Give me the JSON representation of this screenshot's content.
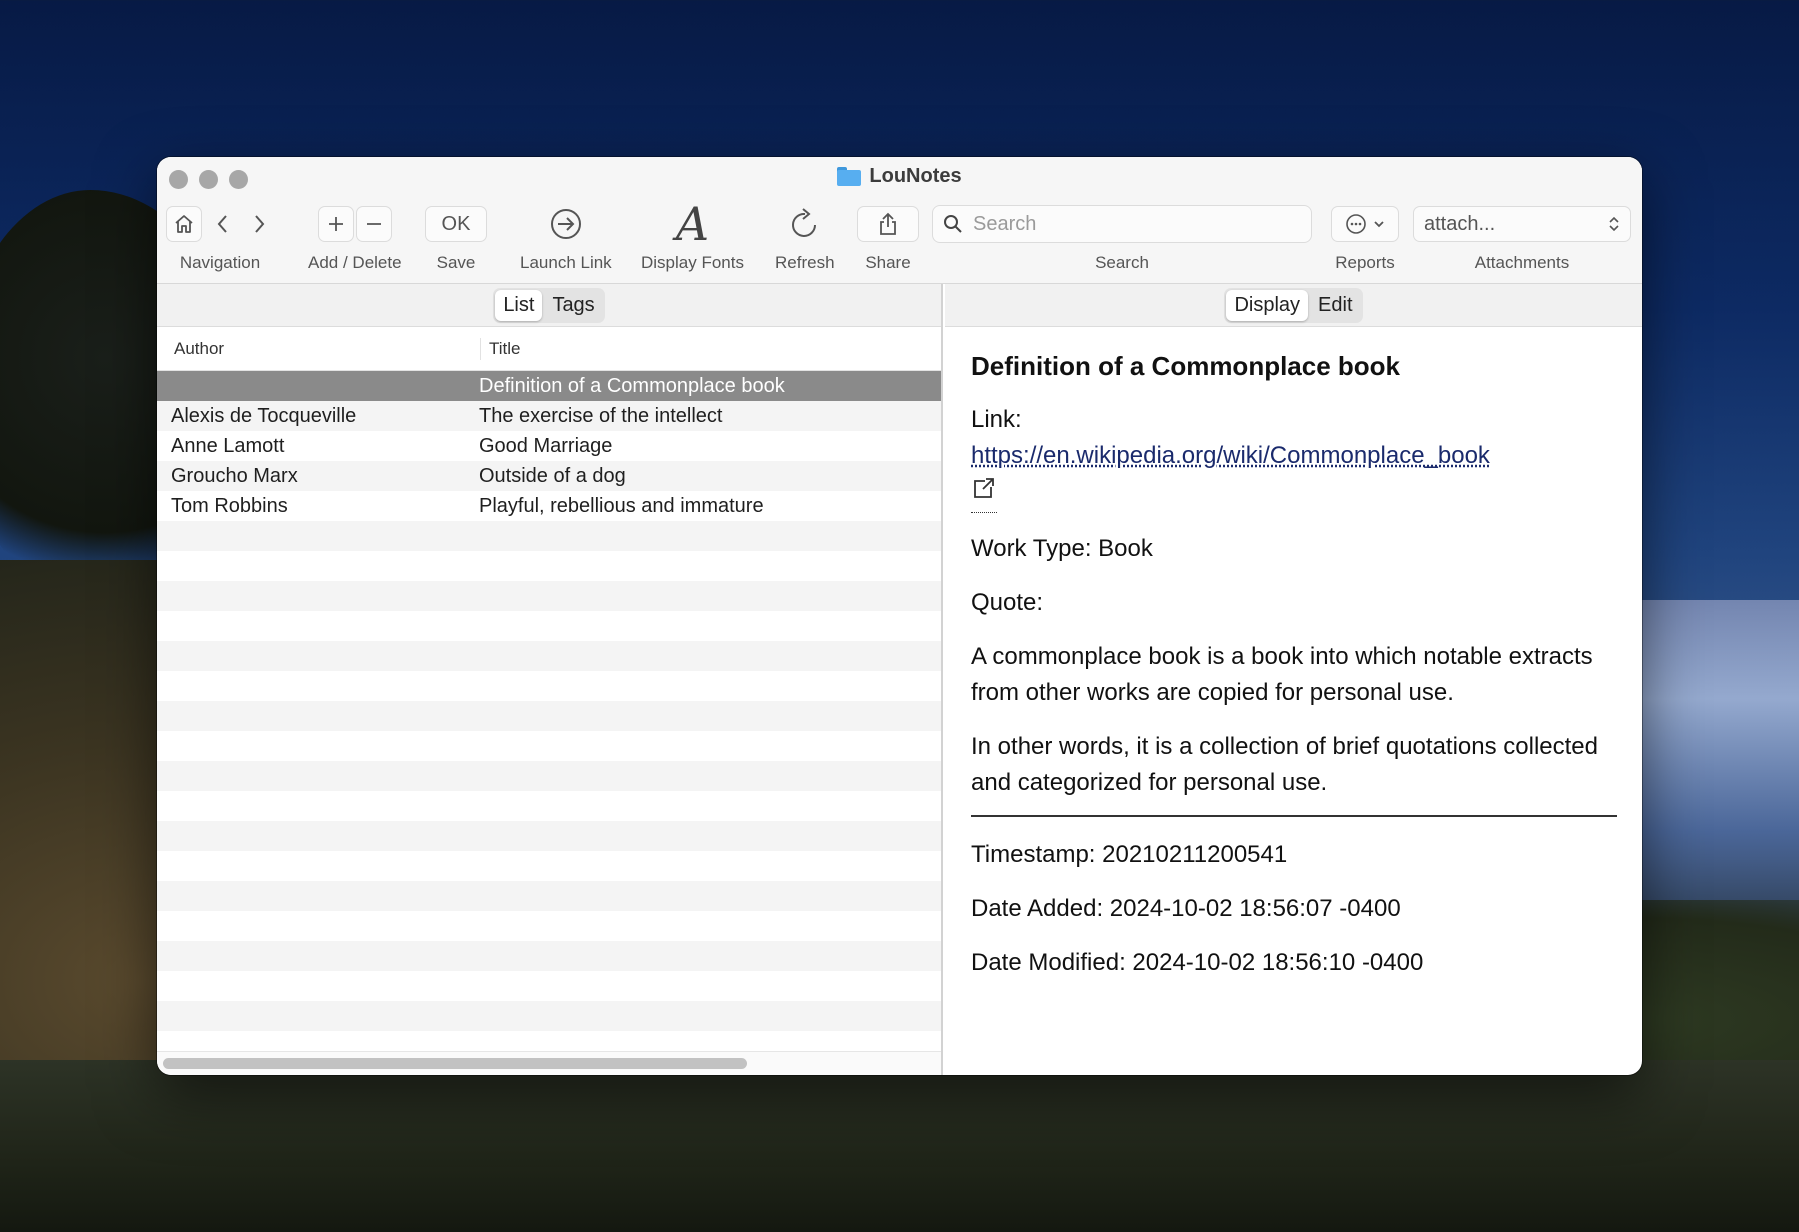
{
  "window": {
    "title": "LouNotes"
  },
  "toolbar": {
    "navigation_label": "Navigation",
    "add_delete_label": "Add / Delete",
    "save_button": "OK",
    "save_label": "Save",
    "launch_link_label": "Launch Link",
    "display_fonts_label": "Display Fonts",
    "refresh_label": "Refresh",
    "share_label": "Share",
    "search_placeholder": "Search",
    "search_label": "Search",
    "reports_label": "Reports",
    "attachments_value": "attach...",
    "attachments_label": "Attachments",
    "icons": [
      "home-icon",
      "chevron-left-icon",
      "chevron-right-icon",
      "plus-icon",
      "minus-icon",
      "launch-link-icon",
      "font-icon",
      "refresh-icon",
      "share-icon",
      "search-icon",
      "ellipsis-icon",
      "chevron-down-icon",
      "updown-chevron-icon"
    ]
  },
  "left": {
    "tabs": [
      "List",
      "Tags"
    ],
    "active_tab": "List",
    "columns": [
      "Author",
      "Title"
    ],
    "rows": [
      {
        "author": "",
        "title": "Definition of a Commonplace book",
        "selected": true
      },
      {
        "author": "Alexis de Tocqueville",
        "title": "The exercise of the intellect"
      },
      {
        "author": "Anne Lamott",
        "title": "Good Marriage"
      },
      {
        "author": "Groucho Marx",
        "title": "Outside of a dog"
      },
      {
        "author": "Tom Robbins",
        "title": "Playful, rebellious and immature"
      }
    ]
  },
  "right": {
    "tabs": [
      "Display",
      "Edit"
    ],
    "active_tab": "Display",
    "note_title": "Definition of a Commonplace book",
    "link_label": "Link:",
    "link_url": "https://en.wikipedia.org/wiki/Commonplace_book",
    "work_type": "Work Type: Book",
    "quote_label": "Quote:",
    "quote_p1": "A commonplace book is a book into which notable extracts from other works are copied for personal use.",
    "quote_p2": "In other words, it is a collection of brief quotations collected and categorized for personal use.",
    "timestamp": "Timestamp: 20210211200541",
    "date_added": "Date Added: 2024-10-02 18:56:07 -0400",
    "date_modified": "Date Modified: 2024-10-02 18:56:10 -0400"
  },
  "colors": {
    "selected_row": "#8a8a8a",
    "link": "#1a2a6c",
    "folder": "#57aef0"
  }
}
